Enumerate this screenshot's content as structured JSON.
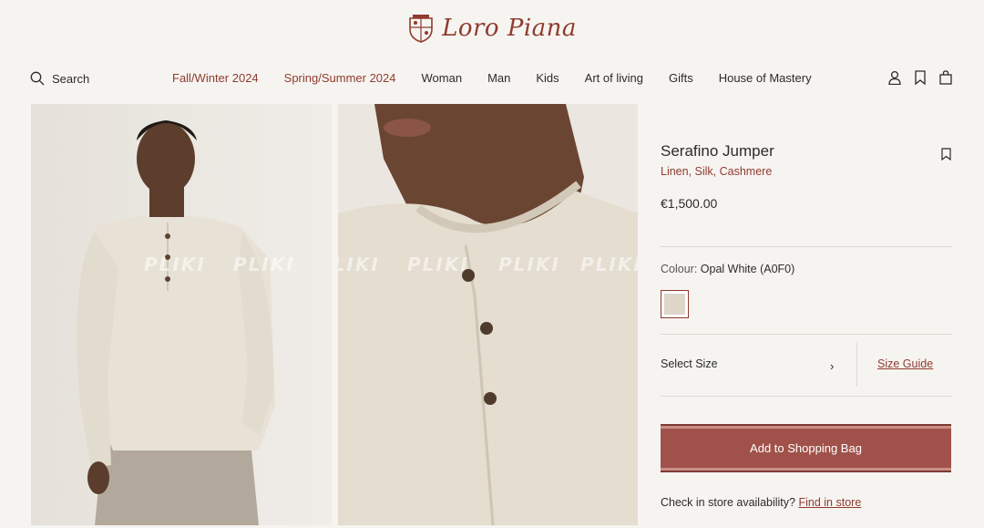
{
  "brand": {
    "logo_text": "Loro Piana",
    "accent_color": "#8f3b2e"
  },
  "header": {
    "search_label": "Search",
    "menu": [
      {
        "label": "Fall/Winter 2024",
        "accent": true
      },
      {
        "label": "Spring/Summer 2024",
        "accent": true
      },
      {
        "label": "Woman"
      },
      {
        "label": "Man"
      },
      {
        "label": "Kids"
      },
      {
        "label": "Art of living"
      },
      {
        "label": "Gifts"
      },
      {
        "label": "House of Mastery"
      }
    ],
    "icons": [
      "account-icon",
      "wishlist-icon",
      "shopping-bag-icon"
    ]
  },
  "gallery": {
    "watermark": "PLIKI"
  },
  "product": {
    "title": "Serafino Jumper",
    "materials": "Linen, Silk, Cashmere",
    "price": "€1,500.00",
    "colour_label": "Colour:",
    "colour_value": "Opal White (A0F0)",
    "swatch_color": "#ddd6c9",
    "select_size": "Select Size",
    "size_guide": "Size Guide",
    "add_to_bag": "Add to Shopping Bag",
    "store_question": "Check in store availability?",
    "store_link": "Find in store"
  }
}
